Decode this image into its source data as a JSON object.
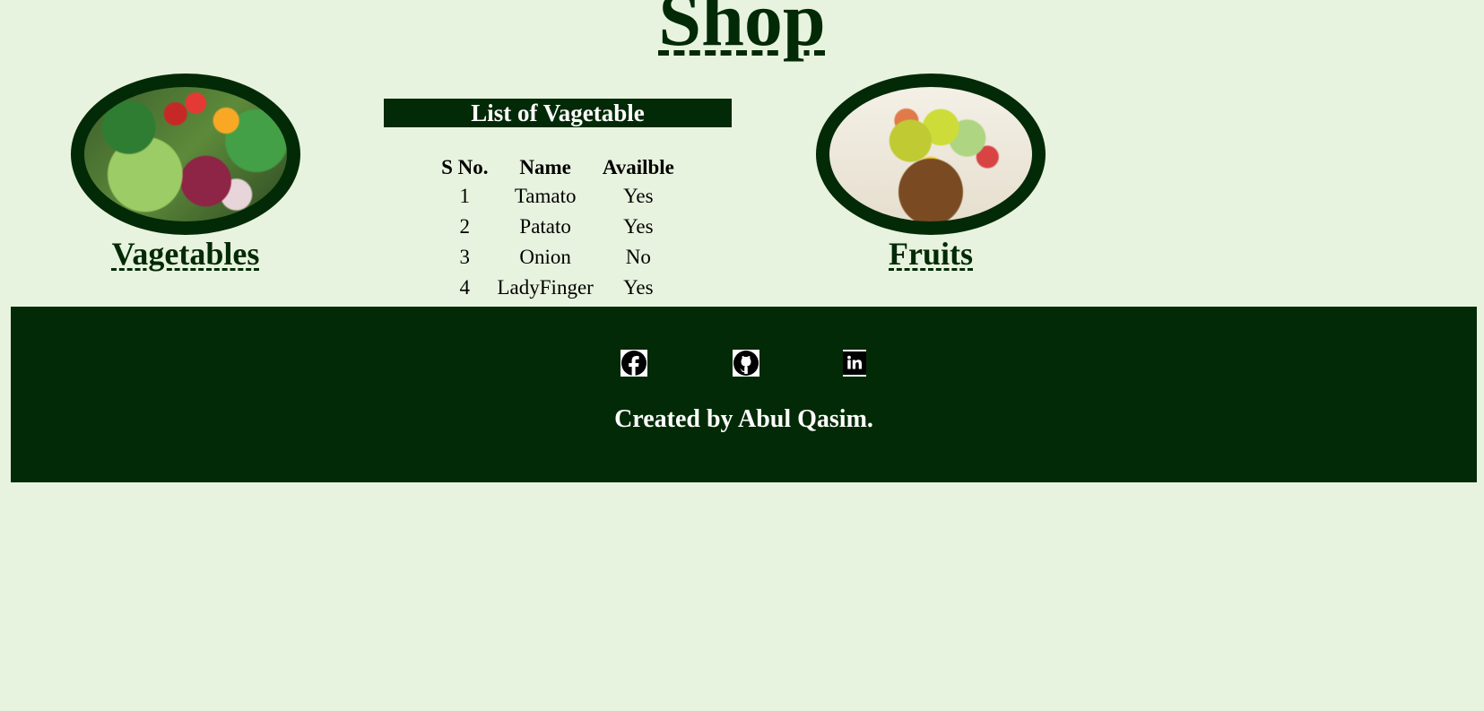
{
  "header": {
    "title": "Shop"
  },
  "cards": {
    "vegetables_label": "Vagetables",
    "fruits_label": "Fruits"
  },
  "vegetable_list": {
    "title": "List of Vagetable",
    "columns": [
      "S No.",
      "Name",
      "Availble"
    ],
    "rows": [
      [
        "1",
        "Tamato",
        "Yes"
      ],
      [
        "2",
        "Patato",
        "Yes"
      ],
      [
        "3",
        "Onion",
        "No"
      ],
      [
        "4",
        "LadyFinger",
        "Yes"
      ]
    ]
  },
  "footer": {
    "icons": [
      "facebook-icon",
      "github-icon",
      "linkedin-icon"
    ],
    "credit": "Created by Abul Qasim."
  },
  "colors": {
    "background": "#e8f3df",
    "brand_dark_green": "#032a06",
    "footer_text": "#ffffff"
  }
}
